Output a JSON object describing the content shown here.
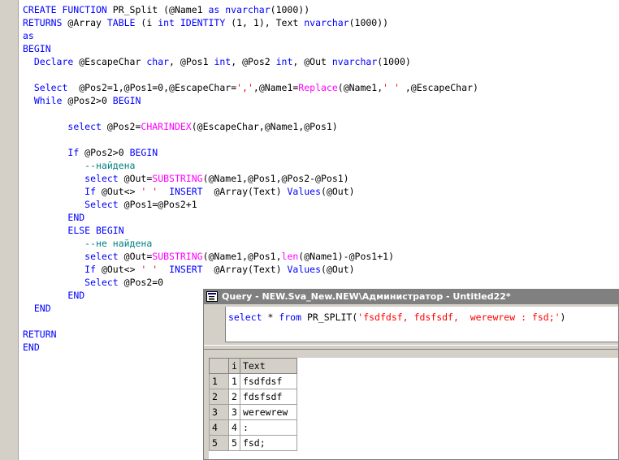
{
  "editor": {
    "lines": [
      [
        {
          "t": "CREATE FUNCTION ",
          "c": "kw"
        },
        {
          "t": "PR_Split (@Name1 "
        },
        {
          "t": "as nvarchar",
          "c": "kw"
        },
        {
          "t": "(1000))"
        }
      ],
      [
        {
          "t": "RETURNS ",
          "c": "kw"
        },
        {
          "t": "@Array "
        },
        {
          "t": "TABLE ",
          "c": "kw"
        },
        {
          "t": "(i "
        },
        {
          "t": "int IDENTITY",
          "c": "kw"
        },
        {
          "t": " (1, 1), Text "
        },
        {
          "t": "nvarchar",
          "c": "kw"
        },
        {
          "t": "(1000))"
        }
      ],
      [
        {
          "t": "as",
          "c": "kw"
        }
      ],
      [
        {
          "t": "BEGIN",
          "c": "kw"
        }
      ],
      [
        {
          "t": "  "
        },
        {
          "t": "Declare ",
          "c": "kw"
        },
        {
          "t": "@EscapeChar "
        },
        {
          "t": "char",
          "c": "kw"
        },
        {
          "t": ", @Pos1 "
        },
        {
          "t": "int",
          "c": "kw"
        },
        {
          "t": ", @Pos2 "
        },
        {
          "t": "int",
          "c": "kw"
        },
        {
          "t": ", @Out "
        },
        {
          "t": "nvarchar",
          "c": "kw"
        },
        {
          "t": "(1000)"
        }
      ],
      [
        {
          "t": ""
        }
      ],
      [
        {
          "t": "  "
        },
        {
          "t": "Select",
          "c": "kw"
        },
        {
          "t": "  @Pos2=1,@Pos1=0,@EscapeChar="
        },
        {
          "t": "','",
          "c": "str"
        },
        {
          "t": ",@Name1="
        },
        {
          "t": "Replace",
          "c": "fn"
        },
        {
          "t": "(@Name1,"
        },
        {
          "t": "' '",
          "c": "str"
        },
        {
          "t": " ,@EscapeChar)"
        }
      ],
      [
        {
          "t": "  "
        },
        {
          "t": "While ",
          "c": "kw"
        },
        {
          "t": "@Pos2>0 "
        },
        {
          "t": "BEGIN",
          "c": "kw"
        }
      ],
      [
        {
          "t": ""
        }
      ],
      [
        {
          "t": "        "
        },
        {
          "t": "select ",
          "c": "kw"
        },
        {
          "t": "@Pos2="
        },
        {
          "t": "CHARINDEX",
          "c": "fn"
        },
        {
          "t": "(@EscapeChar,@Name1,@Pos1)"
        }
      ],
      [
        {
          "t": ""
        }
      ],
      [
        {
          "t": "        "
        },
        {
          "t": "If ",
          "c": "kw"
        },
        {
          "t": "@Pos2>0 "
        },
        {
          "t": "BEGIN",
          "c": "kw"
        }
      ],
      [
        {
          "t": "           "
        },
        {
          "t": "--найдена",
          "c": "cm"
        }
      ],
      [
        {
          "t": "           "
        },
        {
          "t": "select ",
          "c": "kw"
        },
        {
          "t": "@Out="
        },
        {
          "t": "SUBSTRING",
          "c": "fn"
        },
        {
          "t": "(@Name1,@Pos1,@Pos2-@Pos1)"
        }
      ],
      [
        {
          "t": "           "
        },
        {
          "t": "If ",
          "c": "kw"
        },
        {
          "t": "@Out<> "
        },
        {
          "t": "' '",
          "c": "str"
        },
        {
          "t": "  "
        },
        {
          "t": "INSERT",
          "c": "kw"
        },
        {
          "t": "  @Array(Text) "
        },
        {
          "t": "Values",
          "c": "kw"
        },
        {
          "t": "(@Out)"
        }
      ],
      [
        {
          "t": "           "
        },
        {
          "t": "Select ",
          "c": "kw"
        },
        {
          "t": "@Pos1=@Pos2+1"
        }
      ],
      [
        {
          "t": "        "
        },
        {
          "t": "END",
          "c": "kw"
        }
      ],
      [
        {
          "t": "        "
        },
        {
          "t": "ELSE BEGIN",
          "c": "kw"
        }
      ],
      [
        {
          "t": "           "
        },
        {
          "t": "--не найдена",
          "c": "cm"
        }
      ],
      [
        {
          "t": "           "
        },
        {
          "t": "select ",
          "c": "kw"
        },
        {
          "t": "@Out="
        },
        {
          "t": "SUBSTRING",
          "c": "fn"
        },
        {
          "t": "(@Name1,@Pos1,"
        },
        {
          "t": "len",
          "c": "fn"
        },
        {
          "t": "(@Name1)-@Pos1+1)"
        }
      ],
      [
        {
          "t": "           "
        },
        {
          "t": "If ",
          "c": "kw"
        },
        {
          "t": "@Out<> "
        },
        {
          "t": "' '",
          "c": "str"
        },
        {
          "t": "  "
        },
        {
          "t": "INSERT",
          "c": "kw"
        },
        {
          "t": "  @Array(Text) "
        },
        {
          "t": "Values",
          "c": "kw"
        },
        {
          "t": "(@Out)"
        }
      ],
      [
        {
          "t": "           "
        },
        {
          "t": "Select ",
          "c": "kw"
        },
        {
          "t": "@Pos2=0"
        }
      ],
      [
        {
          "t": "        "
        },
        {
          "t": "END",
          "c": "kw"
        }
      ],
      [
        {
          "t": "  "
        },
        {
          "t": "END",
          "c": "kw"
        }
      ],
      [
        {
          "t": ""
        }
      ],
      [
        {
          "t": "RETURN",
          "c": "kw"
        }
      ],
      [
        {
          "t": "END",
          "c": "kw"
        }
      ]
    ]
  },
  "query_window": {
    "title": "Query - NEW.Sva_New.NEW\\Администратор - Untitled22*",
    "query_parts": [
      {
        "t": "select",
        "c": "kw"
      },
      {
        "t": " * "
      },
      {
        "t": "from",
        "c": "kw"
      },
      {
        "t": " PR_SPLIT("
      },
      {
        "t": "'fsdfdsf, fdsfsdf,  werewrew : fsd;'",
        "c": "str"
      },
      {
        "t": ")"
      }
    ],
    "grid": {
      "columns": [
        "i",
        "Text"
      ],
      "rows": [
        {
          "n": "1",
          "i": "1",
          "text": "fsdfdsf"
        },
        {
          "n": "2",
          "i": "2",
          "text": "fdsfsdf"
        },
        {
          "n": "3",
          "i": "3",
          "text": "werewrew"
        },
        {
          "n": "4",
          "i": "4",
          "text": ":"
        },
        {
          "n": "5",
          "i": "5",
          "text": "fsd;"
        }
      ]
    }
  },
  "colors": {
    "keyword": "#0000ff",
    "function": "#ff00ff",
    "string": "#ff0000",
    "comment": "#008080"
  }
}
